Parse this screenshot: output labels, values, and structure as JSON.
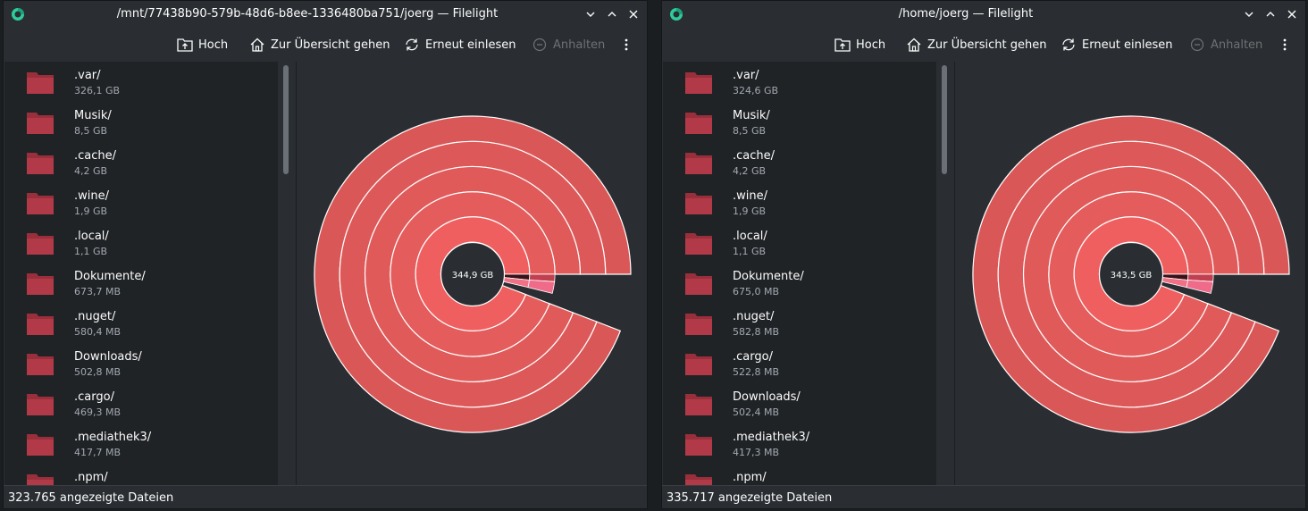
{
  "left_window": {
    "title": "/mnt/77438b90-579b-48d6-b8ee-1336480ba751/joerg — Filelight",
    "toolbar": {
      "up": "Hoch",
      "overview": "Zur Übersicht gehen",
      "rescan": "Erneut einlesen",
      "stop": "Anhalten"
    },
    "items": [
      {
        "name": ".var/",
        "size": "326,1 GB"
      },
      {
        "name": "Musik/",
        "size": "8,5 GB"
      },
      {
        "name": ".cache/",
        "size": "4,2 GB"
      },
      {
        "name": ".wine/",
        "size": "1,9 GB"
      },
      {
        "name": ".local/",
        "size": "1,1 GB"
      },
      {
        "name": "Dokumente/",
        "size": "673,7 MB"
      },
      {
        "name": ".nuget/",
        "size": "580,4 MB"
      },
      {
        "name": "Downloads/",
        "size": "502,8 MB"
      },
      {
        "name": ".cargo/",
        "size": "469,3 MB"
      },
      {
        "name": ".mediathek3/",
        "size": "417,7 MB"
      },
      {
        "name": ".npm/",
        "size": ""
      }
    ],
    "center_label": "344,9 GB",
    "status": "323.765 angezeigte Dateien"
  },
  "right_window": {
    "title": "/home/joerg — Filelight",
    "toolbar": {
      "up": "Hoch",
      "overview": "Zur Übersicht gehen",
      "rescan": "Erneut einlesen",
      "stop": "Anhalten"
    },
    "items": [
      {
        "name": ".var/",
        "size": "324,6 GB"
      },
      {
        "name": "Musik/",
        "size": "8,5 GB"
      },
      {
        "name": ".cache/",
        "size": "4,2 GB"
      },
      {
        "name": ".wine/",
        "size": "1,9 GB"
      },
      {
        "name": ".local/",
        "size": "1,1 GB"
      },
      {
        "name": "Dokumente/",
        "size": "675,0 MB"
      },
      {
        "name": ".nuget/",
        "size": "582,8 MB"
      },
      {
        "name": ".cargo/",
        "size": "522,8 MB"
      },
      {
        "name": "Downloads/",
        "size": "502,4 MB"
      },
      {
        "name": ".mediathek3/",
        "size": "417,3 MB"
      },
      {
        "name": ".npm/",
        "size": ""
      }
    ],
    "center_label": "343,5 GB",
    "status": "335.717 angezeigte Dateien"
  },
  "icons": {
    "app": "filelight-icon",
    "up": "folder-up-icon",
    "overview": "home-icon",
    "rescan": "refresh-icon",
    "stop": "stop-icon",
    "more": "more-vertical-icon",
    "folder": "folder-icon",
    "minimize": "chevron-down-icon",
    "maximize": "chevron-up-icon",
    "close": "close-icon"
  },
  "colors": {
    "background": "#2a2e32",
    "sidebar": "#202326",
    "folder": "#b23a48",
    "ring_main": "#e05a5a",
    "ring_highlight": "#f06a8a",
    "ring_dark": "#3a1216",
    "text": "#fcfcfc",
    "text_dim": "#a1a9b1"
  }
}
